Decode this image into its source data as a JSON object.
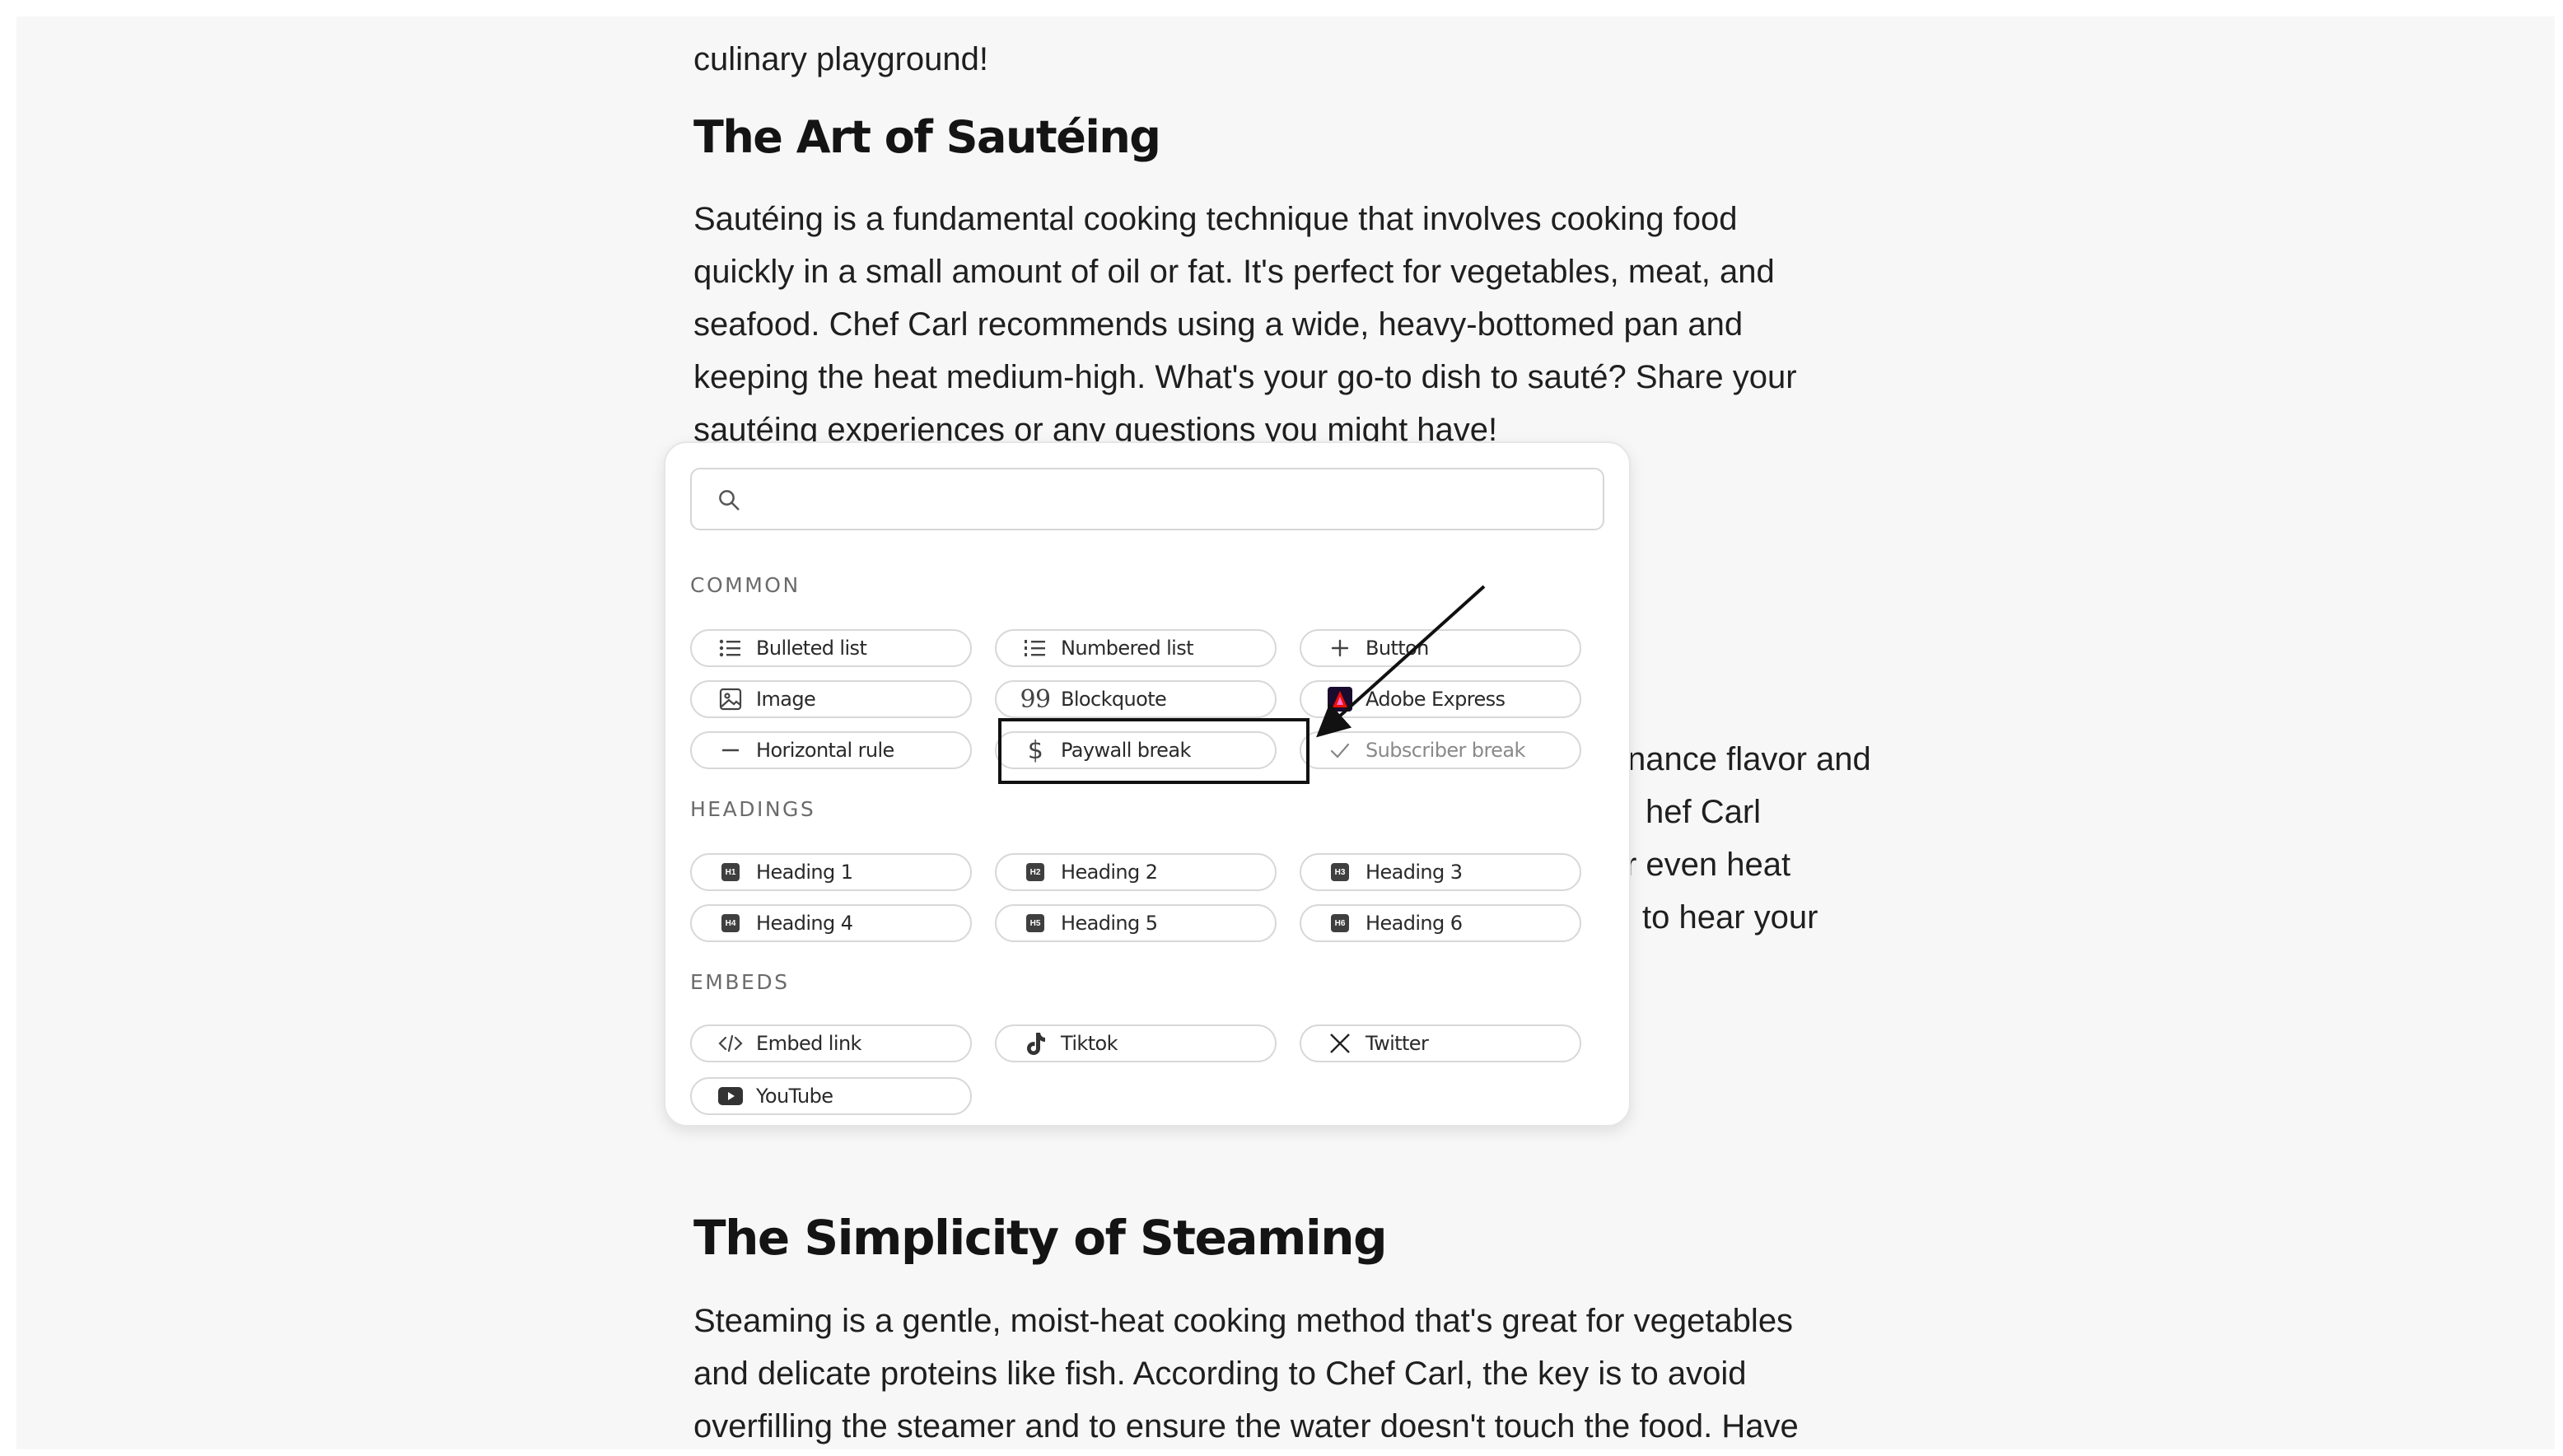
{
  "article": {
    "top_paragraph_tail": "culinary playground!",
    "section1": {
      "heading": "The Art of Sautéing",
      "paragraph": "Sautéing is a fundamental cooking technique that involves cooking food\nquickly in a small amount of oil or fat. It's perfect for vegetables, meat, and\nseafood. Chef Carl recommends using a wide, heavy-bottomed pan and\nkeeping the heat medium-high. What's your go-to dish to sauté? Share your\nsautéing experiences or any questions you might have!"
    },
    "hidden_paragraph_peeks": [
      "nance flavor and",
      "hef Carl",
      "r even heat",
      "to hear your"
    ],
    "section2": {
      "heading": "The Simplicity of Steaming",
      "paragraph": "Steaming is a gentle, moist-heat cooking method that's great for vegetables\nand delicate proteins like fish. According to Chef Carl, the key is to avoid\noverfilling the steamer and to ensure the water doesn't touch the food. Have"
    }
  },
  "insert_menu": {
    "search": {
      "value": "",
      "placeholder": ""
    },
    "sections": {
      "common": {
        "label": "COMMON",
        "items": [
          {
            "label": "Bulleted list",
            "icon": "bulleted-list-icon"
          },
          {
            "label": "Numbered list",
            "icon": "numbered-list-icon"
          },
          {
            "label": "Button",
            "icon": "plus-icon"
          },
          {
            "label": "Image",
            "icon": "image-icon"
          },
          {
            "label": "Blockquote",
            "icon": "quote-icon"
          },
          {
            "label": "Adobe Express",
            "icon": "adobe-express-icon"
          },
          {
            "label": "Horizontal rule",
            "icon": "horizontal-rule-icon"
          },
          {
            "label": "Paywall break",
            "icon": "dollar-icon"
          },
          {
            "label": "Subscriber break",
            "icon": "checkmark-icon",
            "disabled": true
          }
        ]
      },
      "headings": {
        "label": "HEADINGS",
        "items": [
          {
            "label": "Heading 1",
            "badge": "H1"
          },
          {
            "label": "Heading 2",
            "badge": "H2"
          },
          {
            "label": "Heading 3",
            "badge": "H3"
          },
          {
            "label": "Heading 4",
            "badge": "H4"
          },
          {
            "label": "Heading 5",
            "badge": "H5"
          },
          {
            "label": "Heading 6",
            "badge": "H6"
          }
        ]
      },
      "embeds": {
        "label": "EMBEDS",
        "items": [
          {
            "label": "Embed link",
            "icon": "code-icon"
          },
          {
            "label": "Tiktok",
            "icon": "tiktok-icon"
          },
          {
            "label": "Twitter",
            "icon": "x-twitter-icon"
          },
          {
            "label": "YouTube",
            "icon": "youtube-icon"
          }
        ]
      }
    }
  },
  "annotation": {
    "highlighted_item": "Paywall break",
    "color": "#111111"
  },
  "colors": {
    "page_bg": "#f7f7f7",
    "popup_bg": "#ffffff",
    "text": "#1f1f1f",
    "adobe_red": "#eb1000"
  }
}
